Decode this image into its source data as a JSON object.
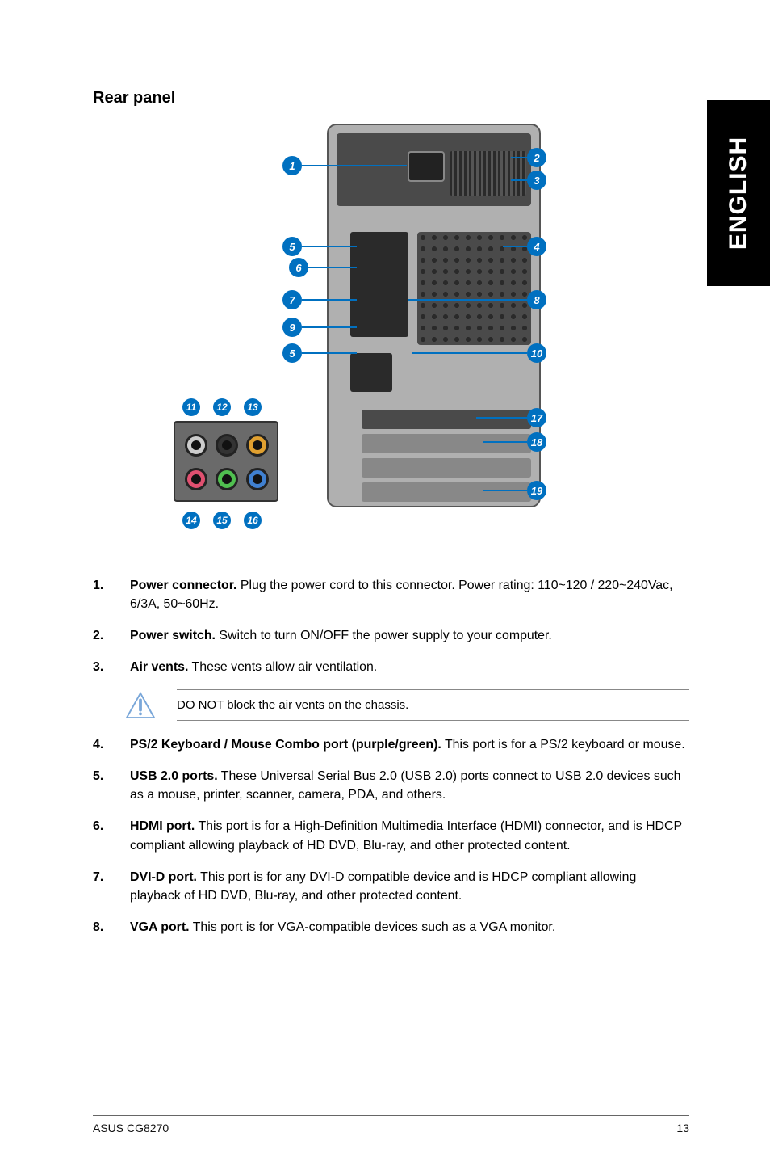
{
  "side_tab": "ENGLISH",
  "section_title": "Rear panel",
  "callouts": {
    "c1": "1",
    "c2": "2",
    "c3": "3",
    "c4": "4",
    "c5a": "5",
    "c5b": "5",
    "c6": "6",
    "c7": "7",
    "c8": "8",
    "c9": "9",
    "c10": "10",
    "z11": "11",
    "z12": "12",
    "z13": "13",
    "z14": "14",
    "z15": "15",
    "z16": "16",
    "c17": "17",
    "c18": "18",
    "c19": "19"
  },
  "list": [
    {
      "n": "1.",
      "bold": "Power connector.",
      "rest": " Plug the power cord to this connector. Power rating: 110~120 / 220~240Vac, 6/3A, 50~60Hz."
    },
    {
      "n": "2.",
      "bold": "Power switch.",
      "rest": " Switch to turn ON/OFF the power supply to your computer."
    },
    {
      "n": "3.",
      "bold": "Air vents.",
      "rest": " These vents allow air ventilation."
    }
  ],
  "note": "DO NOT block the air vents on the chassis.",
  "list2": [
    {
      "n": "4.",
      "bold": "PS/2 Keyboard / Mouse Combo port (purple/green).",
      "rest": " This port is for a PS/2 keyboard or mouse."
    },
    {
      "n": "5.",
      "bold": "USB 2.0 ports.",
      "rest": " These Universal Serial Bus 2.0 (USB 2.0) ports connect to USB 2.0 devices such as a mouse, printer, scanner, camera, PDA, and others."
    },
    {
      "n": "6.",
      "bold": "HDMI port.",
      "rest": " This port is for a High-Definition Multimedia Interface (HDMI) connector, and is HDCP compliant allowing playback of HD DVD, Blu-ray, and other protected content."
    },
    {
      "n": "7.",
      "bold": "DVI-D port.",
      "rest": " This port is for any DVI-D compatible device and is HDCP compliant allowing playback of HD DVD, Blu-ray, and other protected content."
    },
    {
      "n": "8.",
      "bold": "VGA port.",
      "rest": " This port is for VGA-compatible devices such as a VGA monitor."
    }
  ],
  "footer_left": "ASUS CG8270",
  "footer_right": "13"
}
